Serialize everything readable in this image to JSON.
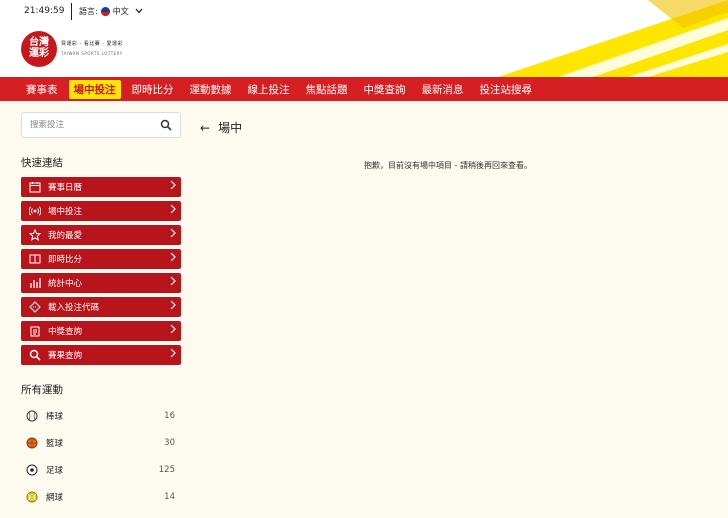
{
  "header": {
    "time": "21:49:59",
    "language_label": "語言:",
    "language_value": "中文",
    "logo_text": "台灣運彩",
    "logo_cn": "買運彩 · 看比賽 · 愛運彩",
    "logo_en": "TAIWAN SPORTS LOTTERY"
  },
  "nav": {
    "items": [
      {
        "label": "賽事表"
      },
      {
        "label": "場中投注"
      },
      {
        "label": "即時比分"
      },
      {
        "label": "運動數據"
      },
      {
        "label": "線上投注"
      },
      {
        "label": "焦點話題"
      },
      {
        "label": "中獎查詢"
      },
      {
        "label": "最新消息"
      },
      {
        "label": "投注站搜尋"
      }
    ],
    "active_index": 1
  },
  "sidebar": {
    "search_placeholder": "搜索投注",
    "quick_title": "快速連結",
    "quick_items": [
      {
        "label": "賽事日曆",
        "icon": "calendar-icon"
      },
      {
        "label": "場中投注",
        "icon": "live-broadcast-icon"
      },
      {
        "label": "我的最愛",
        "icon": "star-icon"
      },
      {
        "label": "即時比分",
        "icon": "scoreboard-icon"
      },
      {
        "label": "統計中心",
        "icon": "bar-chart-icon"
      },
      {
        "label": "載入投注代碼",
        "icon": "ticket-icon"
      },
      {
        "label": "中獎查詢",
        "icon": "clipboard-icon"
      },
      {
        "label": "賽果查詢",
        "icon": "magnifier-icon"
      }
    ],
    "sports_title": "所有運動",
    "sports": [
      {
        "label": "棒球",
        "count": "16",
        "icon": "baseball-icon"
      },
      {
        "label": "籃球",
        "count": "30",
        "icon": "basketball-icon"
      },
      {
        "label": "足球",
        "count": "125",
        "icon": "soccer-icon"
      },
      {
        "label": "網球",
        "count": "14",
        "icon": "tennis-icon"
      }
    ]
  },
  "main": {
    "back_arrow": "←",
    "title": "場中",
    "empty_message": "抱歉，目前沒有場中項目 - 請稍後再回來查看。"
  },
  "colors": {
    "brand_red": "#d51f22",
    "quick_red": "#b8141b",
    "active_yellow": "#ffe600",
    "page_bg": "#fdfbf0"
  }
}
